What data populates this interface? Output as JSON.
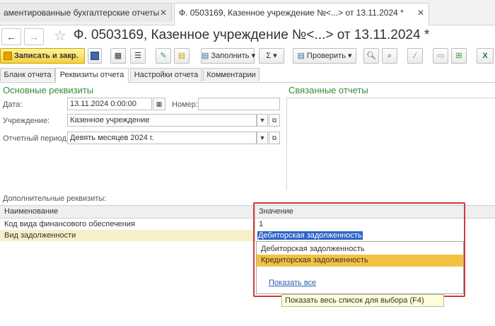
{
  "window_tabs": [
    {
      "label": "аментированные бухгалтерские отчеты",
      "close": "✕"
    },
    {
      "label": "Ф. 0503169, Казенное учреждение №<...> от 13.11.2024 *",
      "close": "✕"
    }
  ],
  "title": "Ф. 0503169, Казенное учреждение №<...> от 13.11.2024 *",
  "toolbar": {
    "save_close": "Записать и закр.",
    "fill": "Заполнить",
    "sigma": "Σ",
    "check": "Проверить"
  },
  "form_tabs": [
    "Бланк отчета",
    "Реквизиты отчета",
    "Настройки отчета",
    "Комментарии"
  ],
  "main": {
    "section_title": "Основные реквизиты",
    "date_label": "Дата:",
    "date_value": "13.11.2024  0:00:00",
    "number_label": "Номер:",
    "number_value": "",
    "institution_label": "Учреждение:",
    "institution_value": "Казенное учреждение",
    "period_label": "Отчетный период:",
    "period_value": "Девять месяцев 2024 г."
  },
  "related": {
    "title": "Связанные отчеты"
  },
  "extra": {
    "title": "Дополнительные реквизиты:",
    "col_name": "Наименование",
    "col_value": "Значение",
    "rows": [
      {
        "name": "Код вида финансового обеспечения",
        "value": "1"
      },
      {
        "name": "Вид задолженности",
        "value": "Дебиторская задолженность"
      }
    ]
  },
  "dropdown": {
    "options": [
      "Дебиторская задолженность",
      "Кредиторская задолженность"
    ],
    "show_all": "Показать все",
    "tooltip": "Показать весь список для выбора (F4)"
  },
  "colors": {
    "accent_green": "#3a8a3a",
    "highlight_red": "#d03a3a",
    "selection_yellow": "#f4c242"
  }
}
